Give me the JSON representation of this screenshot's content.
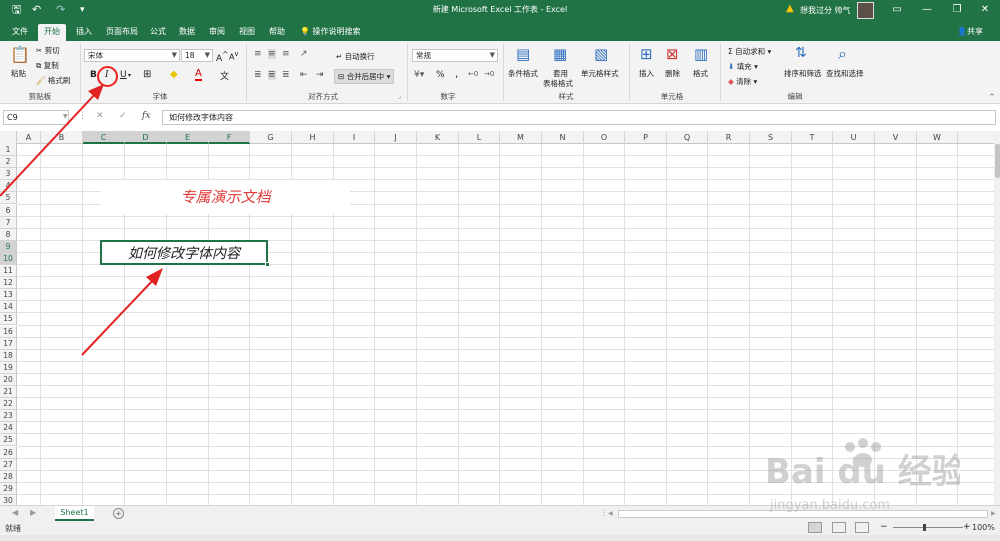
{
  "app": {
    "title": "新建 Microsoft Excel 工作表  -  Excel",
    "user": "想我过分 帅气",
    "window_buttons": [
      "—",
      "❐",
      "□",
      "✕"
    ]
  },
  "quick_access": {
    "save": "🖫",
    "undo": "↶",
    "redo": "↷",
    "more": "▾"
  },
  "tabs": [
    {
      "label": "文件"
    },
    {
      "label": "开始",
      "active": true
    },
    {
      "label": "插入"
    },
    {
      "label": "页面布局"
    },
    {
      "label": "公式"
    },
    {
      "label": "数据"
    },
    {
      "label": "审阅"
    },
    {
      "label": "视图"
    },
    {
      "label": "帮助"
    }
  ],
  "tellme": "操作说明搜索",
  "share": "共享",
  "ribbon": {
    "clipboard": {
      "paste": "粘贴",
      "cut": "剪切",
      "copy": "复制",
      "format_painter": "格式刷",
      "label": "剪贴板"
    },
    "font": {
      "name": "宋体",
      "size": "18",
      "bold": "B",
      "italic": "I",
      "underline": "U",
      "label": "字体"
    },
    "alignment": {
      "wrap": "自动换行",
      "merge": "合并后居中",
      "label": "对齐方式"
    },
    "number": {
      "format": "常规",
      "percent": "%",
      "comma": ",",
      "label": "数字"
    },
    "styles": {
      "conditional": "条件格式",
      "table": "套用",
      "table2": "表格格式",
      "cell_styles": "单元格样式",
      "label": "样式"
    },
    "cells": {
      "insert": "插入",
      "delete": "删除",
      "format": "格式",
      "label": "单元格"
    },
    "editing": {
      "autosum": "自动求和",
      "fill": "填充",
      "clear": "清除",
      "sort": "排序和筛选",
      "find": "查找和选择",
      "label": "编辑"
    }
  },
  "formula_bar": {
    "name_box": "C9",
    "cancel": "✕",
    "enter": "✓",
    "fx": "fx",
    "content": "如何修改字体内容"
  },
  "sheet": {
    "columns": [
      "A",
      "B",
      "C",
      "D",
      "E",
      "F",
      "G",
      "H",
      "I",
      "J",
      "K",
      "L",
      "M",
      "N",
      "O",
      "P",
      "Q",
      "R",
      "S",
      "T",
      "U",
      "V",
      "W"
    ],
    "selected_columns": [
      "C",
      "D",
      "E",
      "F"
    ],
    "rows": [
      "1",
      "2",
      "3",
      "4",
      "5",
      "6",
      "7",
      "8",
      "9",
      "10",
      "11",
      "12",
      "13",
      "14",
      "15",
      "16",
      "17",
      "18",
      "19",
      "20",
      "21",
      "22",
      "23",
      "24",
      "25",
      "26",
      "27",
      "28",
      "29",
      "30"
    ],
    "selected_rows": [
      "9",
      "10"
    ],
    "title_cell": "专属演示文档",
    "active_cell_text": "如何修改字体内容"
  },
  "sheet_tabs": [
    {
      "label": "Sheet1"
    }
  ],
  "add_sheet": "+",
  "status": {
    "ready": "就绪",
    "zoom": "100%"
  },
  "colors": {
    "excel_green": "#217346",
    "annotation_red": "#e22222",
    "title_red": "#e23b3b"
  },
  "watermark": {
    "brand": "Baidu 经验",
    "url": "jingyan.baidu.com"
  }
}
